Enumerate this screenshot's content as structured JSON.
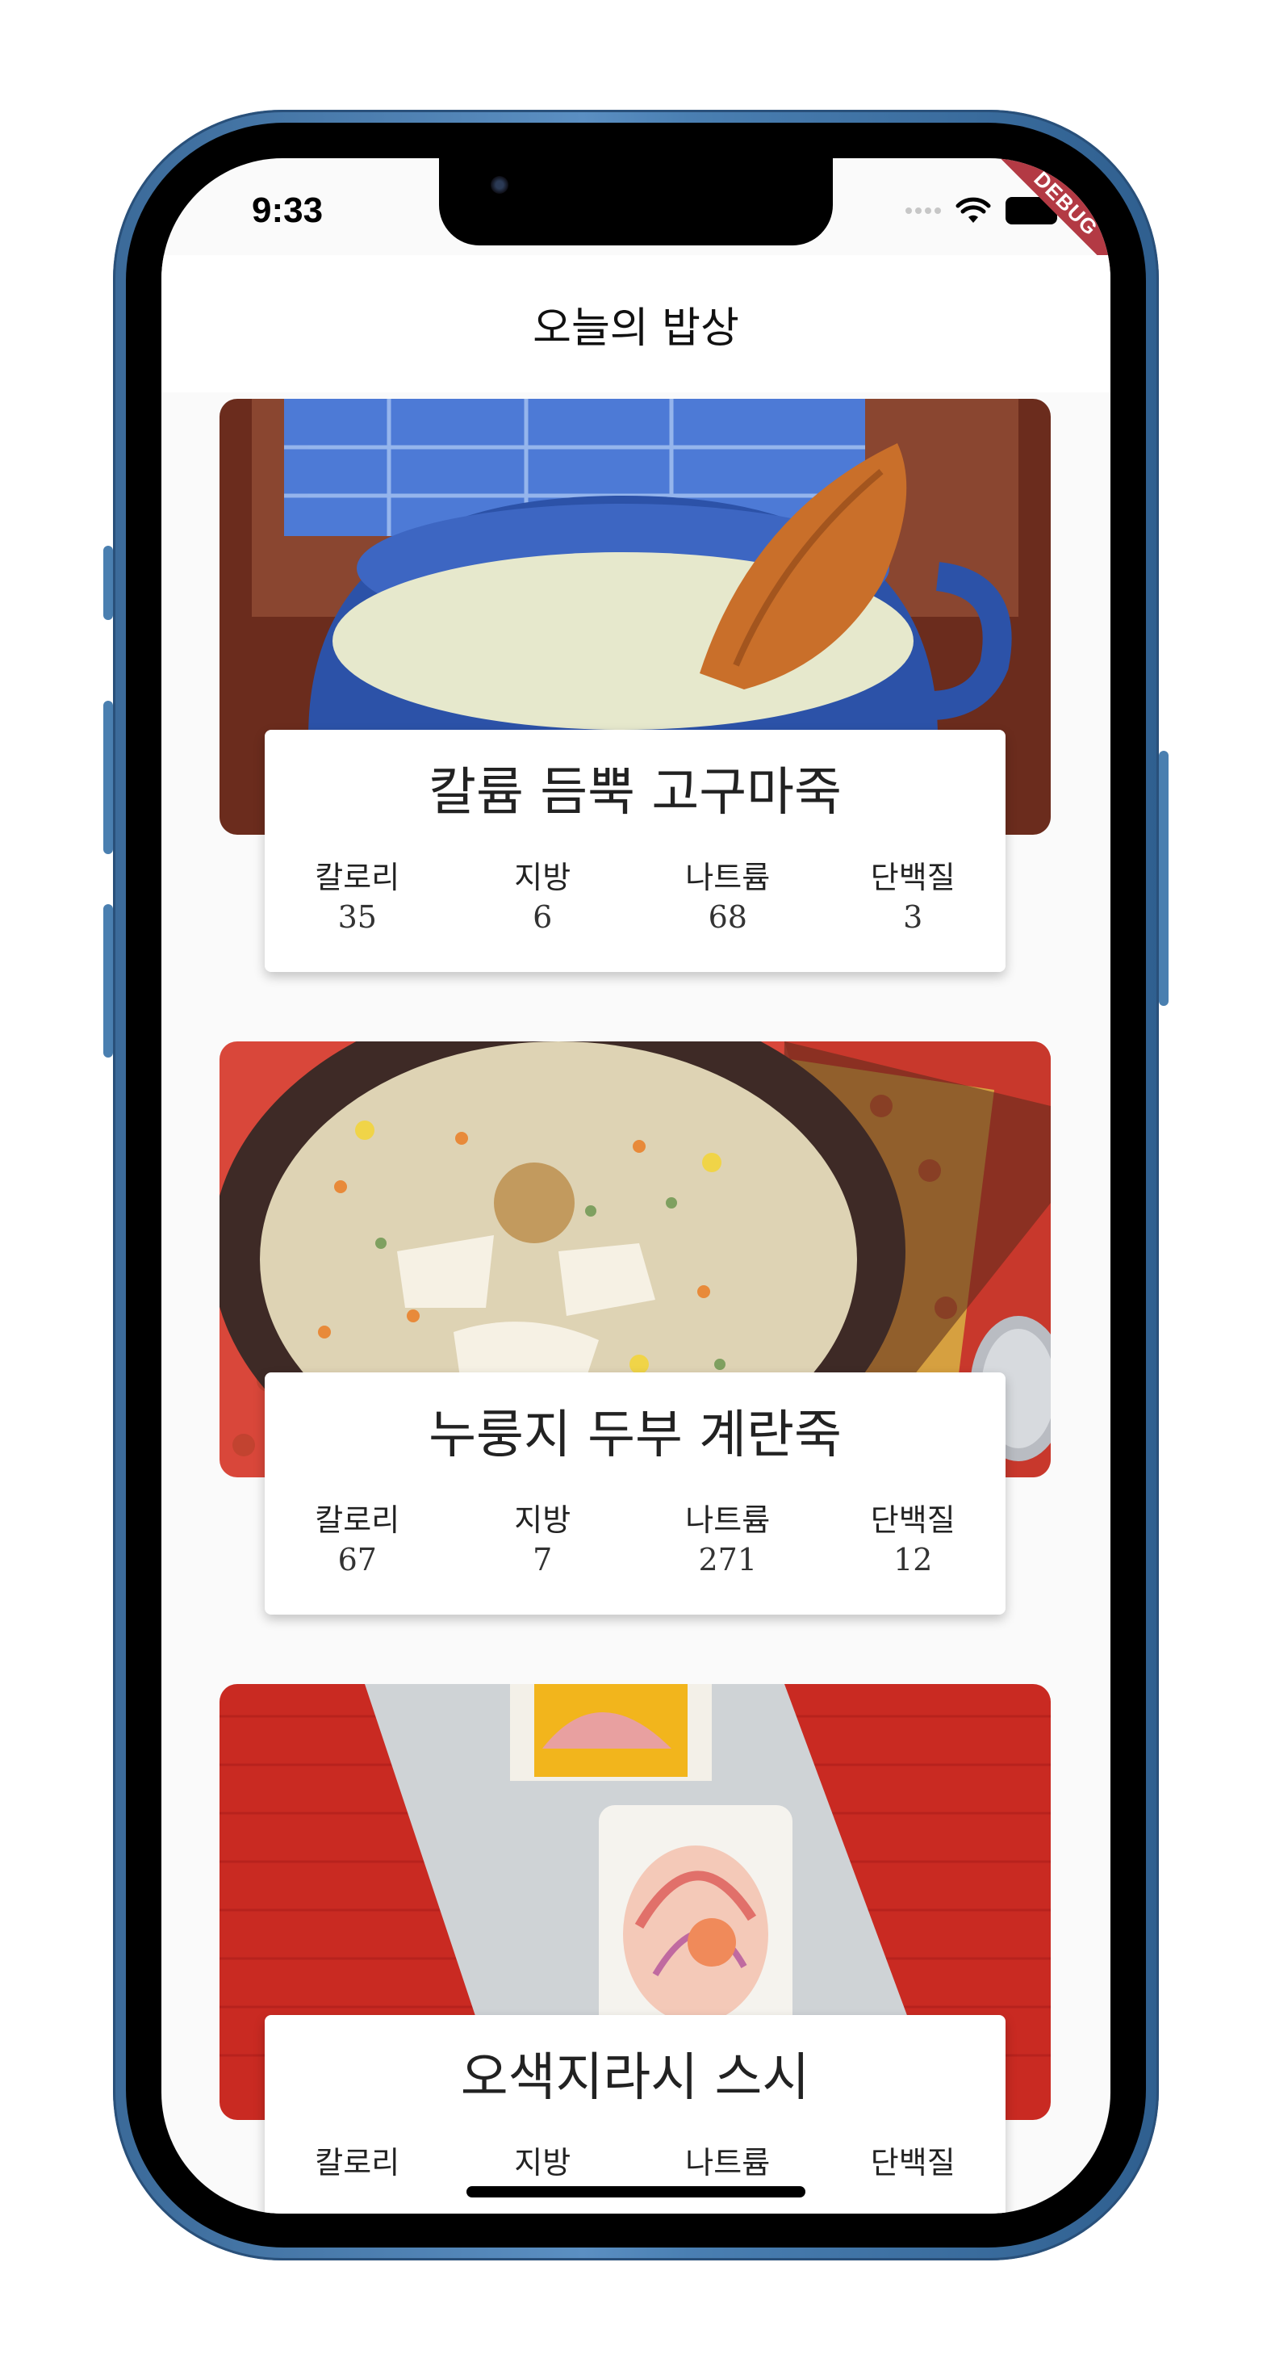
{
  "status_bar": {
    "time": "9:33",
    "debug_label": "DEBUG"
  },
  "app_bar": {
    "title": "오늘의 밥상"
  },
  "nutrition_labels": [
    "칼로리",
    "지방",
    "나트륨",
    "단백질"
  ],
  "recipes": [
    {
      "name": "칼륨 듬뿍 고구마죽",
      "values": [
        "35",
        "6",
        "68",
        "3"
      ]
    },
    {
      "name": "누룽지 두부 계란죽",
      "values": [
        "67",
        "7",
        "271",
        "12"
      ]
    },
    {
      "name": "오색지라시 스시",
      "values": [
        "",
        "",
        "",
        ""
      ]
    }
  ],
  "colors": {
    "frame_blue": "#4a7fb2",
    "debug_ribbon": "#b33a44",
    "screen_background": "#fafafa"
  },
  "icons": [
    "wifi-icon",
    "battery-icon",
    "cellular-signal-icon"
  ]
}
